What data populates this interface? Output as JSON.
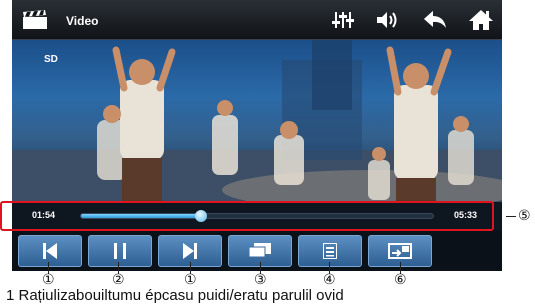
{
  "app": {
    "title": "Video",
    "quality_badge": "SD"
  },
  "top_bar": {
    "icons": [
      "clapper-icon",
      "equalizer-icon",
      "volume-icon",
      "back-arrow-icon",
      "home-icon"
    ]
  },
  "playback": {
    "current_time": "01:54",
    "total_time": "05:33",
    "progress_fraction": 0.34
  },
  "controls": {
    "buttons": [
      "previous-button",
      "pause-button",
      "next-button",
      "subtitles-button",
      "playlist-button",
      "output-switch-button"
    ]
  },
  "callouts": [
    "①",
    "②",
    "①",
    "③",
    "④",
    "⑥",
    "⑤"
  ],
  "caption": "1 Rațiulizabouiltumu épcasu puidi/eratu parulil ovid"
}
